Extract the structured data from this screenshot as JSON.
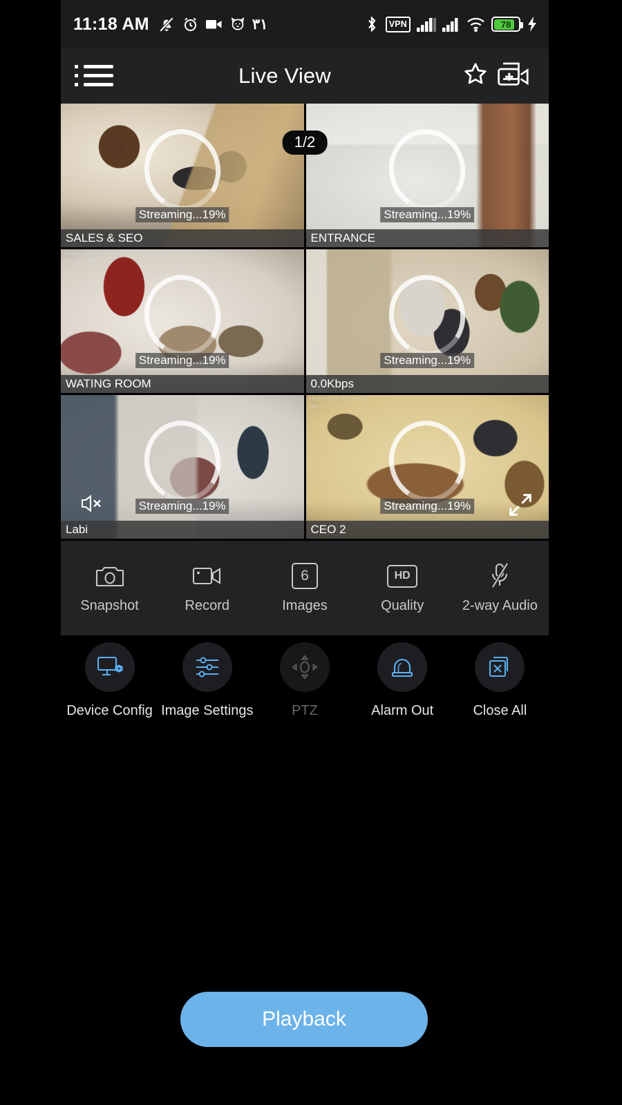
{
  "status_bar": {
    "time": "11:18 AM",
    "notification_count": "٣١",
    "vpn_label": "VPN",
    "battery_level": "78",
    "battery_percent": 78,
    "battery_color": "#4ec83c",
    "icons": [
      "mute-bell-icon",
      "alarm-clock-icon",
      "video-camera-icon",
      "cat-face-icon",
      "bluetooth-icon",
      "vpn-icon",
      "signal-1-icon",
      "signal-2-icon",
      "wifi-icon",
      "battery-icon",
      "charging-bolt-icon"
    ]
  },
  "header": {
    "title": "Live View",
    "menu_icon": "list-menu-icon",
    "favorite_icon": "star-icon",
    "add_icon": "add-camera-icon"
  },
  "grid": {
    "page_indicator": "1/2",
    "tiles": [
      {
        "label": "SALES & SEO",
        "status": "Streaming...19%",
        "osd": "",
        "osd2": "",
        "scene": "s1",
        "overlay": null
      },
      {
        "label": "ENTRANCE",
        "status": "Streaming...19%",
        "osd": "",
        "osd2": "",
        "scene": "s2",
        "overlay": null
      },
      {
        "label": "WATING ROOM",
        "status": "Streaming...19%",
        "osd": "Image: HD Rate: 8K",
        "osd2": "WATING ROOM",
        "scene": "s3",
        "overlay": null
      },
      {
        "label": "0.0Kbps",
        "status": "Streaming...19%",
        "osd": "",
        "osd2": "",
        "scene": "s4",
        "overlay": null
      },
      {
        "label": "Labi",
        "status": "Streaming...19%",
        "osd": "",
        "osd2": "",
        "scene": "s5",
        "overlay": "mute"
      },
      {
        "label": "CEO 2",
        "status": "Streaming...19%",
        "osd": "22/07/2022 11:18:12",
        "osd2": "CEO 2",
        "scene": "s6",
        "overlay": "expand"
      }
    ]
  },
  "control_bar": {
    "items": [
      {
        "label": "Snapshot",
        "icon": "camera-icon",
        "badge": ""
      },
      {
        "label": "Record",
        "icon": "video-record-icon",
        "badge": ""
      },
      {
        "label": "Images",
        "icon": "images-count-icon",
        "badge": "6"
      },
      {
        "label": "Quality",
        "icon": "quality-icon",
        "badge": "HD"
      },
      {
        "label": "2-way Audio",
        "icon": "microphone-off-icon",
        "badge": ""
      }
    ]
  },
  "device_bar": {
    "items": [
      {
        "label": "Device Config",
        "icon": "monitor-gear-icon",
        "enabled": true
      },
      {
        "label": "Image Settings",
        "icon": "sliders-icon",
        "enabled": true
      },
      {
        "label": "PTZ",
        "icon": "ptz-dpad-icon",
        "enabled": false
      },
      {
        "label": "Alarm Out",
        "icon": "alarm-siren-icon",
        "enabled": true
      },
      {
        "label": "Close All",
        "icon": "close-all-icon",
        "enabled": true
      }
    ]
  },
  "playback": {
    "label": "Playback",
    "color": "#6cb3ea"
  }
}
